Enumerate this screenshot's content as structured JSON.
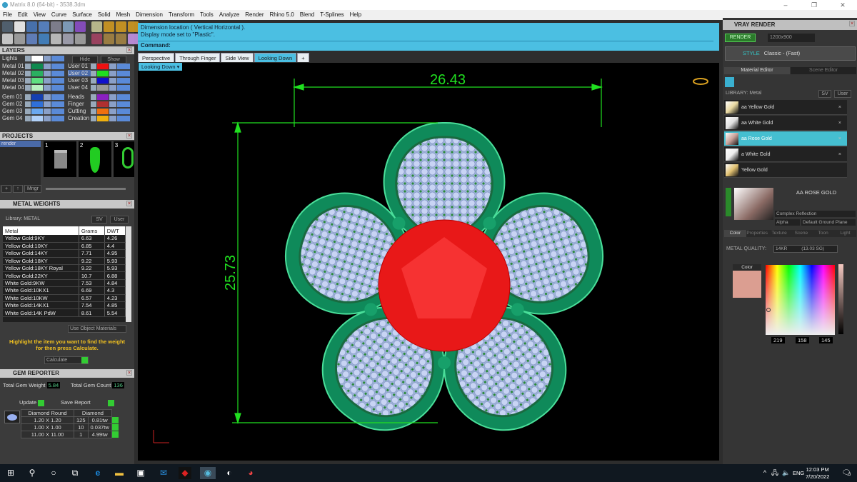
{
  "window": {
    "title": "Matrix 8.0 (64-bit) - 3538.3dm",
    "controls": [
      "–",
      "❐",
      "✕"
    ]
  },
  "menu": [
    "File",
    "Edit",
    "View",
    "Curve",
    "Surface",
    "Solid",
    "Mesh",
    "Dimension",
    "Transform",
    "Tools",
    "Analyze",
    "Render",
    "Rhino 5.0",
    "Blend",
    "T-Splines",
    "Help"
  ],
  "layers": {
    "title": "LAYERS",
    "hide": "Hide",
    "show": "Show",
    "left": [
      {
        "name": "Lights",
        "color": "#ffffff"
      },
      {
        "name": "Metal 01",
        "color": "#0f8a4e"
      },
      {
        "name": "Metal 02",
        "color": "#2ab060"
      },
      {
        "name": "Metal 03",
        "color": "#5ee080"
      },
      {
        "name": "Metal 04",
        "color": "#b8f0c0"
      },
      {
        "name": "Gem 01",
        "color": "#1540b0"
      },
      {
        "name": "Gem 02",
        "color": "#2f70d8"
      },
      {
        "name": "Gem 03",
        "color": "#6aa8f0"
      },
      {
        "name": "Gem 04",
        "color": "#b0d0f8"
      }
    ],
    "right": [
      {
        "name": "User 01",
        "color": "#ee1010"
      },
      {
        "name": "User 02",
        "color": "#20dd20"
      },
      {
        "name": "User 03",
        "color": "#1010cc"
      },
      {
        "name": "User 04",
        "color": "#999999"
      },
      {
        "name": "Heads",
        "color": "#8a20c0"
      },
      {
        "name": "Finger",
        "color": "#b03030"
      },
      {
        "name": "Cutting",
        "color": "#f07010"
      },
      {
        "name": "Creation",
        "color": "#f0b010"
      }
    ]
  },
  "projects": {
    "title": "PROJECTS",
    "items": [
      "render"
    ],
    "thumbs": [
      "1",
      "2",
      "3"
    ],
    "mngr": "Mngr"
  },
  "metal_weights": {
    "title": "METAL WEIGHTS",
    "library": "Library: METAL",
    "sv": "SV",
    "user": "User",
    "columns": [
      "Metal",
      "Grams",
      "DWT"
    ],
    "rows": [
      [
        "Yellow Gold:9KY",
        "6.63",
        "4.26"
      ],
      [
        "Yellow Gold:10KY",
        "6.85",
        "4.4"
      ],
      [
        "Yellow Gold:14KY",
        "7.71",
        "4.95"
      ],
      [
        "Yellow Gold:18KY",
        "9.22",
        "5.93"
      ],
      [
        "Yellow Gold:18KY Royal",
        "9.22",
        "5.93"
      ],
      [
        "Yellow Gold:22KY",
        "10.7",
        "6.88"
      ],
      [
        "White Gold:9KW",
        "7.53",
        "4.84"
      ],
      [
        "White Gold:10KX1",
        "6.69",
        "4.3"
      ],
      [
        "White Gold:10KW",
        "6.57",
        "4.23"
      ],
      [
        "White Gold:14KX1",
        "7.54",
        "4.85"
      ],
      [
        "White Gold:14K PdW",
        "8.61",
        "5.54"
      ]
    ],
    "use_object_materials": "Use Object Materials",
    "hint": "Highlight the item you want to find the weight for then press Calculate.",
    "calculate": "Calculate"
  },
  "gem_reporter": {
    "title": "GEM REPORTER",
    "total_weight_label": "Total Gem Weight",
    "total_weight": "5.84",
    "total_count_label": "Total Gem Count",
    "total_count": "136",
    "update": "Update",
    "save_report": "Save Report",
    "headers": [
      "Diamond Round",
      "Diamond"
    ],
    "rows": [
      [
        "1.20 X 1.20",
        "125",
        "0.81tw"
      ],
      [
        "1.00 X 1.00",
        "10",
        "0.037tw"
      ],
      [
        "11.00 X 11.00",
        "1",
        "4.99tw"
      ]
    ]
  },
  "command": {
    "line1": "Dimension location ( Vertical  Horizontal ).",
    "line2": "Display mode set to \"Plastic\".",
    "prompt": "Command:"
  },
  "viewport": {
    "tabs": [
      "Perspective",
      "Through Finger",
      "Side View",
      "Looking Down"
    ],
    "active_tab": "Looking Down",
    "label": "Looking Down",
    "dim_horizontal": "26.43",
    "dim_vertical": "25.73"
  },
  "vray": {
    "title": "VRAY RENDER",
    "render": "RENDER",
    "resolution": "1200x900",
    "style_label": "STYLE",
    "style": "Classic - (Fast)",
    "tabs": [
      "Material Editor",
      "Scene Editor"
    ],
    "library": "LIBRARY: Metal",
    "sv": "SV",
    "user": "User",
    "materials": [
      "aa Yellow Gold",
      "aa White Gold",
      "aa Rose Gold",
      "a White Gold",
      "Yellow Gold"
    ],
    "selected_material": "aa Rose Gold",
    "material_name": "AA ROSE GOLD",
    "reflection": "Complex Reflection",
    "alpha": "Alpha",
    "ground": "Default Ground Plane",
    "subtabs": [
      "Color",
      "Properties",
      "Texture",
      "Scene",
      "Toon",
      "Light"
    ],
    "metal_quality_label": "METAL QUALITY:",
    "metal_quality": "14KR",
    "metal_quality_density": "(13.03 SG)",
    "color_label": "Color",
    "swatch": "#db9e91",
    "r": "219",
    "g": "158",
    "b": "145"
  },
  "taskbar": {
    "lang": "ENG",
    "time": "12:03 PM",
    "date": "7/20/2022",
    "notifications": "3"
  },
  "colors": {
    "accent": "#4bbfe2",
    "gem": "#e81818",
    "metal": "#0f8a5a",
    "dimension": "#20e020"
  }
}
